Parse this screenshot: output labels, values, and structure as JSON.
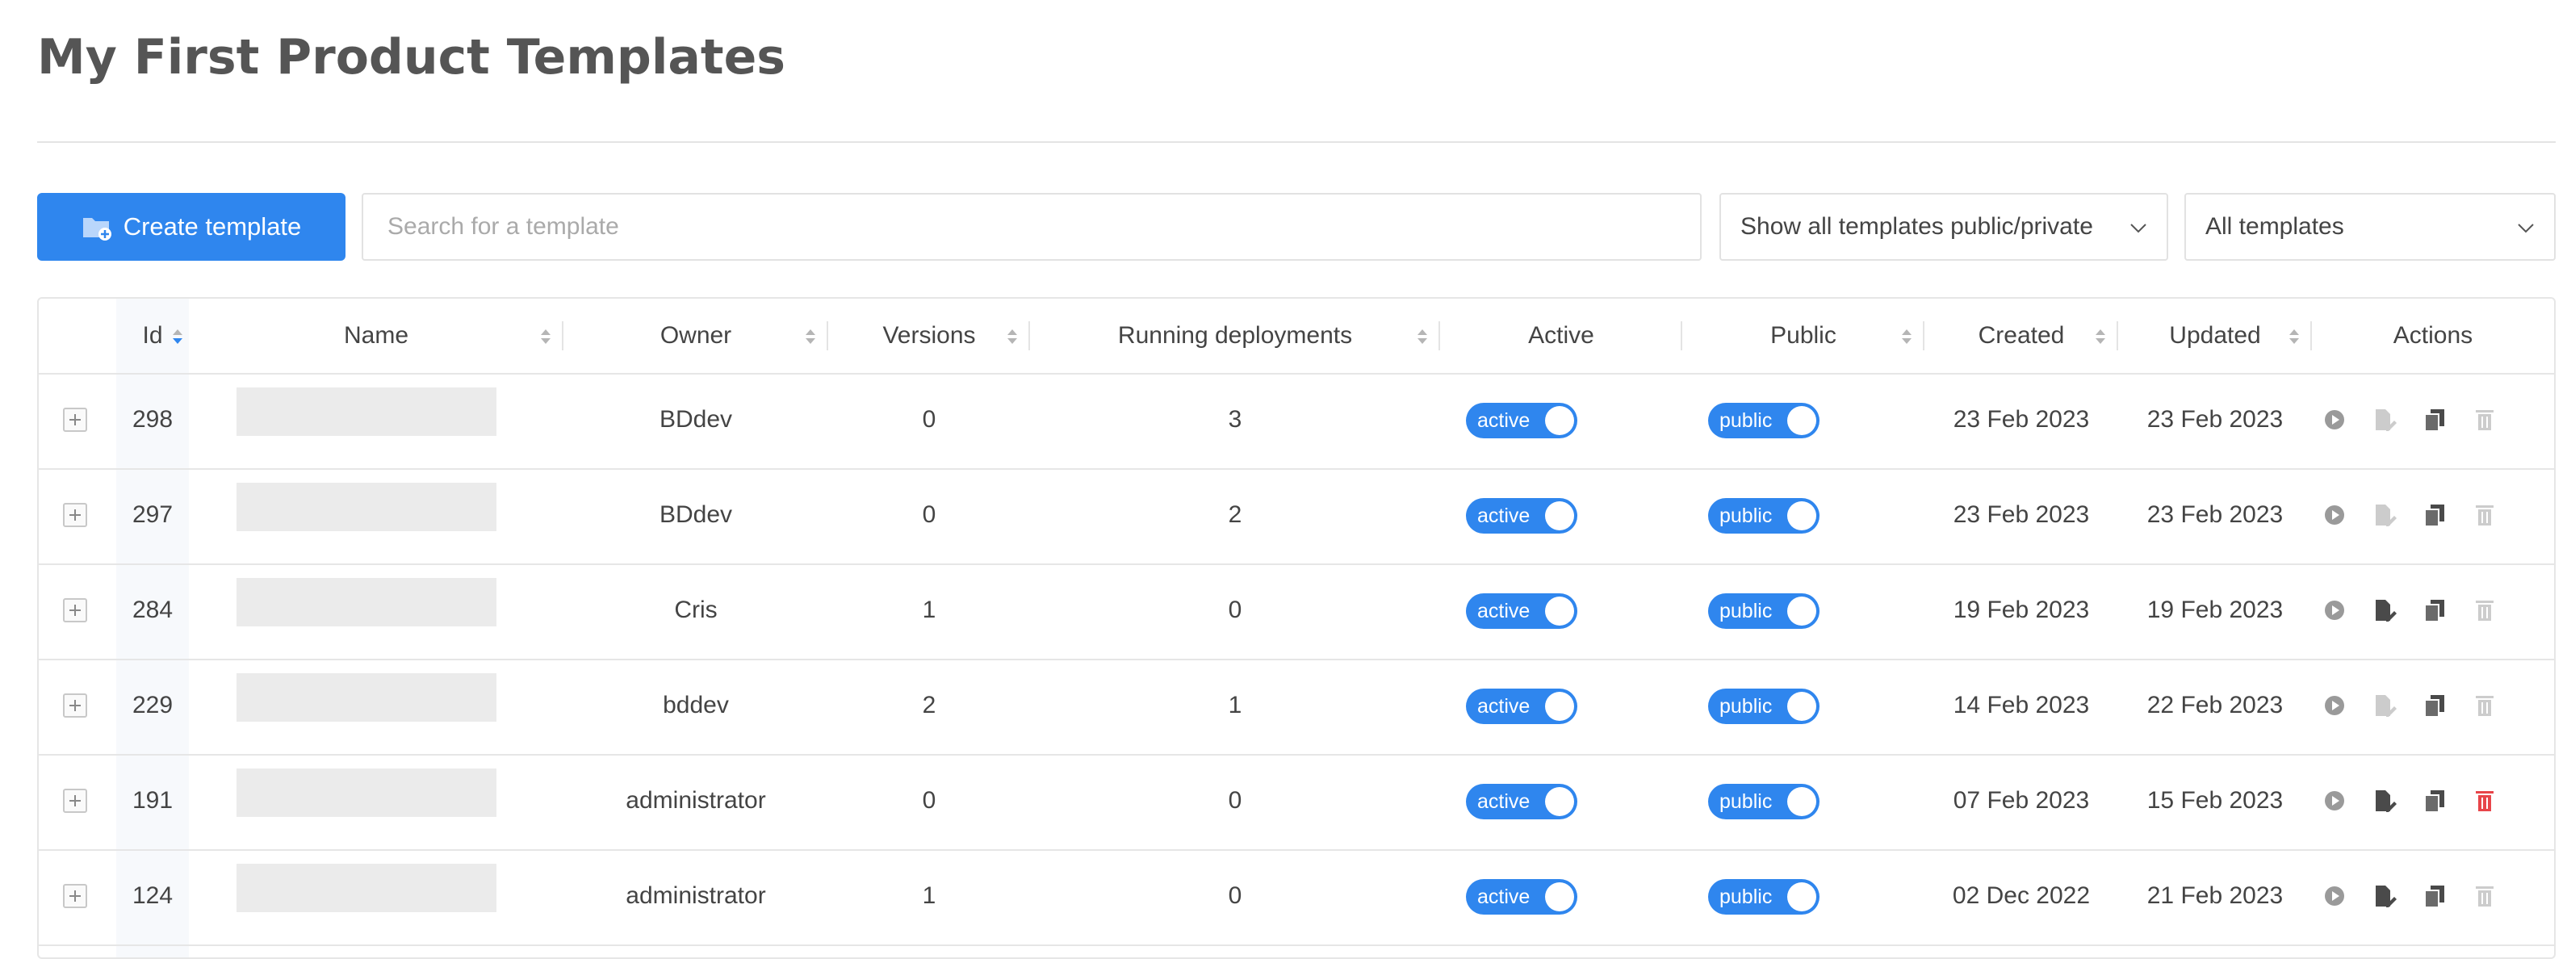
{
  "page": {
    "title": "My First Product Templates"
  },
  "toolbar": {
    "create_label": "Create template",
    "search_placeholder": "Search for a template",
    "visibility_filter": "Show all templates public/private",
    "template_filter": "All templates"
  },
  "table": {
    "headers": {
      "id": "Id",
      "name": "Name",
      "owner": "Owner",
      "versions": "Versions",
      "running": "Running deployments",
      "active": "Active",
      "public": "Public",
      "created": "Created",
      "updated": "Updated",
      "actions": "Actions"
    },
    "rows": [
      {
        "id": "298",
        "owner": "BDdev",
        "versions": "0",
        "running": "3",
        "active": "active",
        "public": "public",
        "created": "23 Feb 2023",
        "updated": "23 Feb 2023",
        "edit_enabled": false,
        "delete_enabled": false
      },
      {
        "id": "297",
        "owner": "BDdev",
        "versions": "0",
        "running": "2",
        "active": "active",
        "public": "public",
        "created": "23 Feb 2023",
        "updated": "23 Feb 2023",
        "edit_enabled": false,
        "delete_enabled": false
      },
      {
        "id": "284",
        "owner": "Cris",
        "versions": "1",
        "running": "0",
        "active": "active",
        "public": "public",
        "created": "19 Feb 2023",
        "updated": "19 Feb 2023",
        "edit_enabled": true,
        "delete_enabled": false
      },
      {
        "id": "229",
        "owner": "bddev",
        "versions": "2",
        "running": "1",
        "active": "active",
        "public": "public",
        "created": "14 Feb 2023",
        "updated": "22 Feb 2023",
        "edit_enabled": false,
        "delete_enabled": false
      },
      {
        "id": "191",
        "owner": "administrator",
        "versions": "0",
        "running": "0",
        "active": "active",
        "public": "public",
        "created": "07 Feb 2023",
        "updated": "15 Feb 2023",
        "edit_enabled": true,
        "delete_enabled": true
      },
      {
        "id": "124",
        "owner": "administrator",
        "versions": "1",
        "running": "0",
        "active": "active",
        "public": "public",
        "created": "02 Dec 2022",
        "updated": "21 Feb 2023",
        "edit_enabled": true,
        "delete_enabled": false
      }
    ]
  },
  "colors": {
    "accent": "#2f86ee",
    "delete_active": "#e8454a",
    "disabled": "#cccccc"
  }
}
